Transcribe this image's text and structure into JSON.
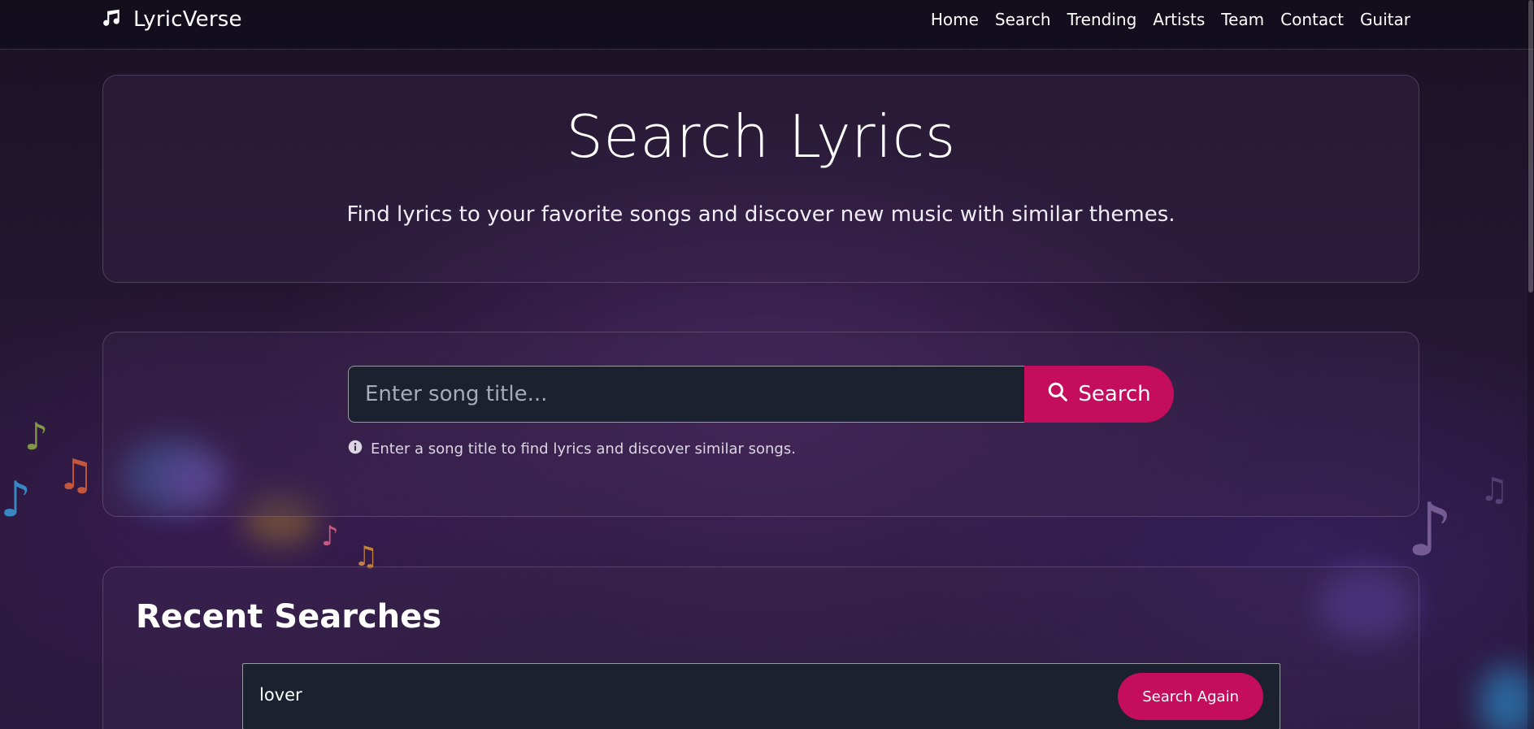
{
  "navbar": {
    "brand": "LyricVerse",
    "links": [
      "Home",
      "Search",
      "Trending",
      "Artists",
      "Team",
      "Contact",
      "Guitar"
    ]
  },
  "hero": {
    "title": "Search Lyrics",
    "subtitle": "Find lyrics to your favorite songs and discover new music with similar themes."
  },
  "search": {
    "placeholder": "Enter song title...",
    "value": "",
    "button_label": "Search",
    "hint": "Enter a song title to find lyrics and discover similar songs."
  },
  "recent": {
    "title": "Recent Searches",
    "items": [
      {
        "term": "lover",
        "button_label": "Search Again"
      }
    ]
  },
  "colors": {
    "accent": "#c40d5c",
    "input_bg": "#1c2130",
    "page_bg": "#241733"
  },
  "icons": {
    "brand": "music-note-icon",
    "search": "search-icon",
    "hint": "info-icon"
  }
}
